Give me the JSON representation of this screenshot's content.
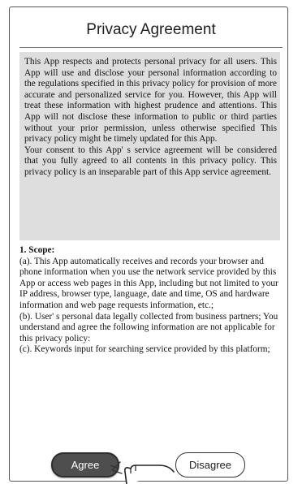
{
  "dialog": {
    "title": "Privacy Agreement",
    "intro_paragraph_1": "This App respects and protects personal privacy for all users. This App will use and disclose your personal information according to the regulations specified in this privacy policy for provision of more accurate and personalized service for you. However, this App will treat these information with highest prudence and attentions. This App will not disclose these information to public or third parties without your prior permission, unless otherwise specified This privacy policy might be timely updated for this App.",
    "intro_paragraph_2": "Your consent to this App' s service agreement will be considered that you fully agreed to all contents in this privacy policy. This privacy policy is an inseparable part of this App service agreement.",
    "scope_heading": "1. Scope:",
    "scope_a": "(a). This App automatically receives and records your browser and phone information when you use the network service provided by this App or access web pages in this App, including but not limited to your IP address, browser type, language, date and time, OS and hardware information and web page requests information, etc.;",
    "scope_b": "(b). User' s personal data legally collected from business partners; You understand and agree the following information are not applicable for this privacy policy:",
    "scope_c": "(c). Keywords input for searching service provided by this platform;",
    "agree_label": "Agree",
    "disagree_label": "Disagree"
  },
  "colors": {
    "intro_background": "#dedede",
    "agree_background": "#4e4e4e",
    "frame_border": "#555555"
  },
  "icons": {
    "pointer": "hand-pointer-icon"
  }
}
